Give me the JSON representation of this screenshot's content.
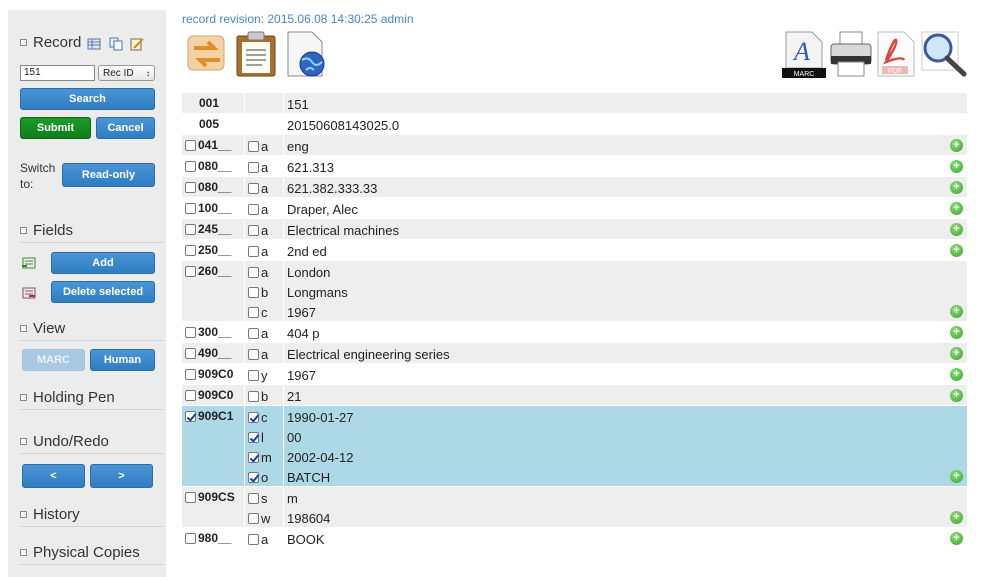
{
  "sidebar": {
    "record": {
      "title": "Record",
      "input_value": "151",
      "select_value": "Rec ID",
      "search_label": "Search",
      "submit_label": "Submit",
      "cancel_label": "Cancel"
    },
    "switch": {
      "label": "Switch to:",
      "button_label": "Read-only"
    },
    "fields": {
      "title": "Fields",
      "add_label": "Add",
      "delete_label": "Delete selected"
    },
    "view": {
      "title": "View",
      "marc_label": "MARC",
      "human_label": "Human"
    },
    "holding_pen": {
      "title": "Holding Pen"
    },
    "undo_redo": {
      "title": "Undo/Redo",
      "undo_label": "<",
      "redo_label": ">"
    },
    "history": {
      "title": "History"
    },
    "physical_copies": {
      "title": "Physical Copies"
    }
  },
  "main": {
    "revision": "record revision: 2015.06.08 14:30:25 admin",
    "export_marc_label": "MARC",
    "export_pdf_label": "PDF"
  },
  "fields": [
    {
      "tag": "001",
      "checkbox": false,
      "subs": [
        {
          "code": "",
          "value": "151"
        }
      ]
    },
    {
      "tag": "005",
      "checkbox": false,
      "subs": [
        {
          "code": "",
          "value": "20150608143025.0"
        }
      ]
    },
    {
      "tag": "041__",
      "checkbox": true,
      "subs": [
        {
          "code": "a",
          "value": "eng"
        }
      ]
    },
    {
      "tag": "080__",
      "checkbox": true,
      "subs": [
        {
          "code": "a",
          "value": "621.313"
        }
      ]
    },
    {
      "tag": "080__",
      "checkbox": true,
      "subs": [
        {
          "code": "a",
          "value": "621.382.333.33"
        }
      ]
    },
    {
      "tag": "100__",
      "checkbox": true,
      "subs": [
        {
          "code": "a",
          "value": "Draper, Alec"
        }
      ]
    },
    {
      "tag": "245__",
      "checkbox": true,
      "subs": [
        {
          "code": "a",
          "value": "Electrical machines"
        }
      ]
    },
    {
      "tag": "250__",
      "checkbox": true,
      "subs": [
        {
          "code": "a",
          "value": "2nd ed"
        }
      ]
    },
    {
      "tag": "260__",
      "checkbox": true,
      "subs": [
        {
          "code": "a",
          "value": "London"
        },
        {
          "code": "b",
          "value": "Longmans"
        },
        {
          "code": "c",
          "value": "1967"
        }
      ]
    },
    {
      "tag": "300__",
      "checkbox": true,
      "subs": [
        {
          "code": "a",
          "value": "404 p"
        }
      ]
    },
    {
      "tag": "490__",
      "checkbox": true,
      "subs": [
        {
          "code": "a",
          "value": "Electrical engineering series"
        }
      ]
    },
    {
      "tag": "909C0",
      "checkbox": true,
      "subs": [
        {
          "code": "y",
          "value": "1967"
        }
      ]
    },
    {
      "tag": "909C0",
      "checkbox": true,
      "subs": [
        {
          "code": "b",
          "value": "21"
        }
      ]
    },
    {
      "tag": "909C1",
      "checkbox": true,
      "checked": true,
      "subs": [
        {
          "code": "c",
          "value": "1990-01-27"
        },
        {
          "code": "l",
          "value": "00"
        },
        {
          "code": "m",
          "value": "2002-04-12"
        },
        {
          "code": "o",
          "value": "BATCH"
        }
      ]
    },
    {
      "tag": "909CS",
      "checkbox": true,
      "subs": [
        {
          "code": "s",
          "value": "m"
        },
        {
          "code": "w",
          "value": "198604"
        }
      ]
    },
    {
      "tag": "980__",
      "checkbox": true,
      "subs": [
        {
          "code": "a",
          "value": "BOOK"
        }
      ]
    }
  ],
  "colors": {
    "accent": "#3b88cc",
    "submit": "#168a22",
    "selected_row": "#add8e6",
    "revision_link": "#4a86c5"
  }
}
